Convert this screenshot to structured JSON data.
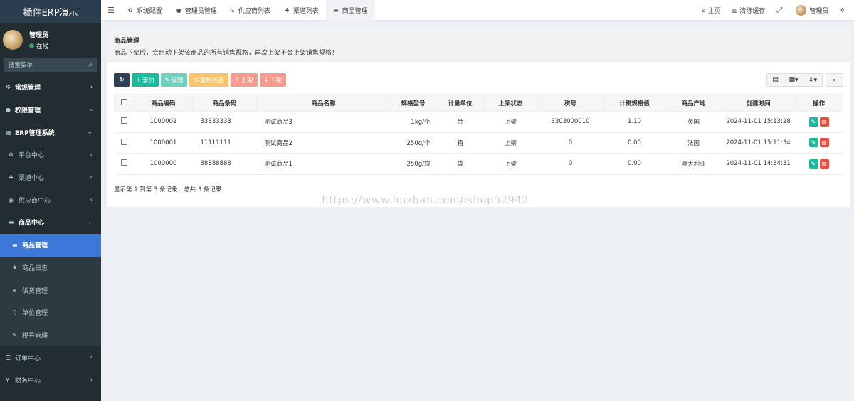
{
  "app": {
    "logo": "插件ERP演示"
  },
  "user": {
    "name": "管理员",
    "status": "在线"
  },
  "sidebar": {
    "search_placeholder": "搜索菜单",
    "items": [
      {
        "label": "常规管理",
        "icon": "gears-icon",
        "arrow": "‹"
      },
      {
        "label": "权限管理",
        "icon": "group-icon",
        "arrow": "‹"
      },
      {
        "label": "ERP管理系统",
        "icon": "table-icon",
        "arrow": "⌄"
      },
      {
        "label": "平台中心",
        "icon": "gear-icon",
        "arrow": "‹"
      },
      {
        "label": "渠道中心",
        "icon": "sitemap-icon",
        "arrow": "‹"
      },
      {
        "label": "供应商中心",
        "icon": "globe-icon",
        "arrow": "‹"
      },
      {
        "label": "商品中心",
        "icon": "briefcase-icon",
        "arrow": "⌄"
      },
      {
        "label": "商品管理",
        "icon": "briefcase-icon",
        "arrow": ""
      },
      {
        "label": "商品日志",
        "icon": "tint-icon",
        "arrow": ""
      },
      {
        "label": "供货管理",
        "icon": "bars-icon",
        "arrow": ""
      },
      {
        "label": "单位管理",
        "icon": "music-icon",
        "arrow": ""
      },
      {
        "label": "税号管理",
        "icon": "brush-icon",
        "arrow": ""
      },
      {
        "label": "订单中心",
        "icon": "list-icon",
        "arrow": "‹"
      },
      {
        "label": "财务中心",
        "icon": "yen-icon",
        "arrow": "‹"
      }
    ]
  },
  "topbar": {
    "tabs": [
      {
        "label": "系统配置",
        "icon": "gear-icon"
      },
      {
        "label": "管理员管理",
        "icon": "user-icon"
      },
      {
        "label": "供应商列表",
        "icon": "dollar-icon"
      },
      {
        "label": "渠道列表",
        "icon": "channel-icon"
      },
      {
        "label": "商品管理",
        "icon": "briefcase-icon"
      }
    ],
    "right": {
      "home": "主页",
      "clear_cache": "清除缓存",
      "admin": "管理员"
    }
  },
  "notice": {
    "title": "商品管理",
    "desc": "商品下架后，会自动下架该商品的所有销售规格，再次上架不会上架销售规格！"
  },
  "toolbar": {
    "add": "添加",
    "edit": "编辑",
    "copy": "复制商品",
    "up": "上架",
    "down": "下架"
  },
  "table": {
    "headers": [
      "商品编码",
      "商品条码",
      "商品名称",
      "规格型号",
      "计量单位",
      "上架状态",
      "税号",
      "计税规格值",
      "商品产地",
      "创建时间",
      "操作"
    ],
    "rows": [
      {
        "code": "1000002",
        "barcode": "33333333",
        "name": "测试商品3",
        "spec": "1kg/个",
        "unit": "台",
        "status": "上架",
        "tax": "3303000010",
        "taxval": "1.10",
        "origin": "英国",
        "created": "2024-11-01 15:13:28"
      },
      {
        "code": "1000001",
        "barcode": "11111111",
        "name": "测试商品2",
        "spec": "250g/个",
        "unit": "箱",
        "status": "上架",
        "tax": "0",
        "taxval": "0.00",
        "origin": "法国",
        "created": "2024-11-01 15:11:34"
      },
      {
        "code": "1000000",
        "barcode": "88888888",
        "name": "测试商品1",
        "spec": "250g/袋",
        "unit": "袋",
        "status": "上架",
        "tax": "0",
        "taxval": "0.00",
        "origin": "澳大利亚",
        "created": "2024-11-01 14:34:31"
      }
    ]
  },
  "pager": {
    "summary": "显示第 1 到第 3 条记录，总共 3 条记录"
  },
  "watermark": {
    "url": "https://www.huzhan.com/ishop52942"
  },
  "colors": {
    "sidebar_bg": "#222d32",
    "active": "#3c78d8",
    "add": "#18bc9c",
    "danger": "#e74c3c",
    "warning": "#f8c36a"
  }
}
